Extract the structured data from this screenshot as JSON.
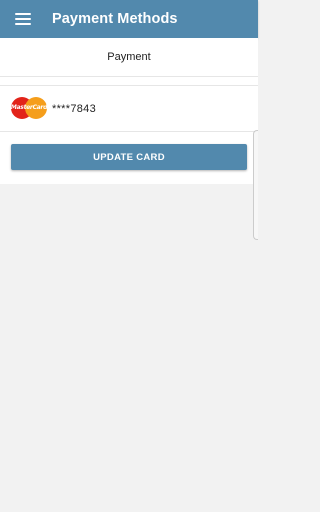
{
  "appbar": {
    "title": "Payment Methods",
    "menu_icon": "hamburger-menu-icon"
  },
  "payment": {
    "section_title": "Payment",
    "card": {
      "brand": "MasterCard",
      "brand_icon": "mastercard-logo-icon",
      "masked_number": "****7843"
    },
    "update_button_label": "UPDATE CARD"
  },
  "colors": {
    "primary": "#5289ad",
    "background": "#f2f2f2",
    "mastercard_red": "#e2231a",
    "mastercard_orange": "#f59e1b"
  }
}
